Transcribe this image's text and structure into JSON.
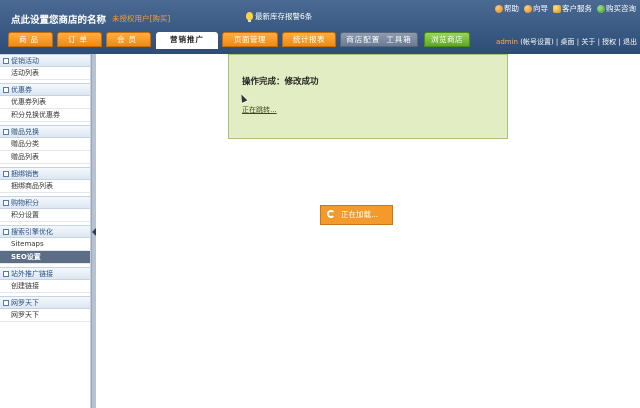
{
  "header": {
    "shop_title": "点此设置您商店的名称",
    "unauth_text": "未授权用户[购买]",
    "alert_text": "最新库存报警6条",
    "top_links": [
      {
        "label": "帮助",
        "icon": "help-icon"
      },
      {
        "label": "向导",
        "icon": "guide-icon"
      },
      {
        "label": "客户服务",
        "icon": "customer-service-icon"
      },
      {
        "label": "购买咨询",
        "icon": "purchase-consult-icon"
      }
    ]
  },
  "nav": {
    "tabs": [
      "商品",
      "订单",
      "会员",
      "营销推广",
      "页面管理",
      "统计报表"
    ],
    "active_tab": "营销推广",
    "config_label": "商店配置",
    "toolbox_label": "工具箱",
    "browse_label": "浏览商店"
  },
  "admin_links": {
    "user": "admin",
    "account_settings": "(帐号设置)",
    "desktop": "桌面",
    "about": "关于",
    "license": "授权",
    "logout": "退出"
  },
  "sidebar": {
    "groups": [
      {
        "title": "促销活动",
        "items": [
          "活动列表"
        ]
      },
      {
        "title": "优惠券",
        "items": [
          "优惠券列表",
          "积分兑换优惠券"
        ]
      },
      {
        "title": "赠品兑换",
        "items": [
          "赠品分类",
          "赠品列表"
        ]
      },
      {
        "title": "捆绑销售",
        "items": [
          "捆绑商品列表"
        ]
      },
      {
        "title": "购物积分",
        "items": [
          "积分设置"
        ]
      },
      {
        "title": "搜索引擎优化",
        "items": [
          "Sitemaps",
          "SEO设置"
        ]
      },
      {
        "title": "站外推广链接",
        "items": [
          "创建链接"
        ]
      },
      {
        "title": "网罗天下",
        "items": [
          "网罗天下"
        ]
      }
    ],
    "active_item": "SEO设置"
  },
  "content": {
    "message_title": "操作完成：修改成功",
    "redirect_link": "正在跳转...",
    "loading_text": "正在加载..."
  },
  "colors": {
    "header_bg": "#3a5a84",
    "tab_orange": "#f08a10",
    "message_bg": "#e3edc3",
    "loading_bg": "#f39a2b"
  }
}
